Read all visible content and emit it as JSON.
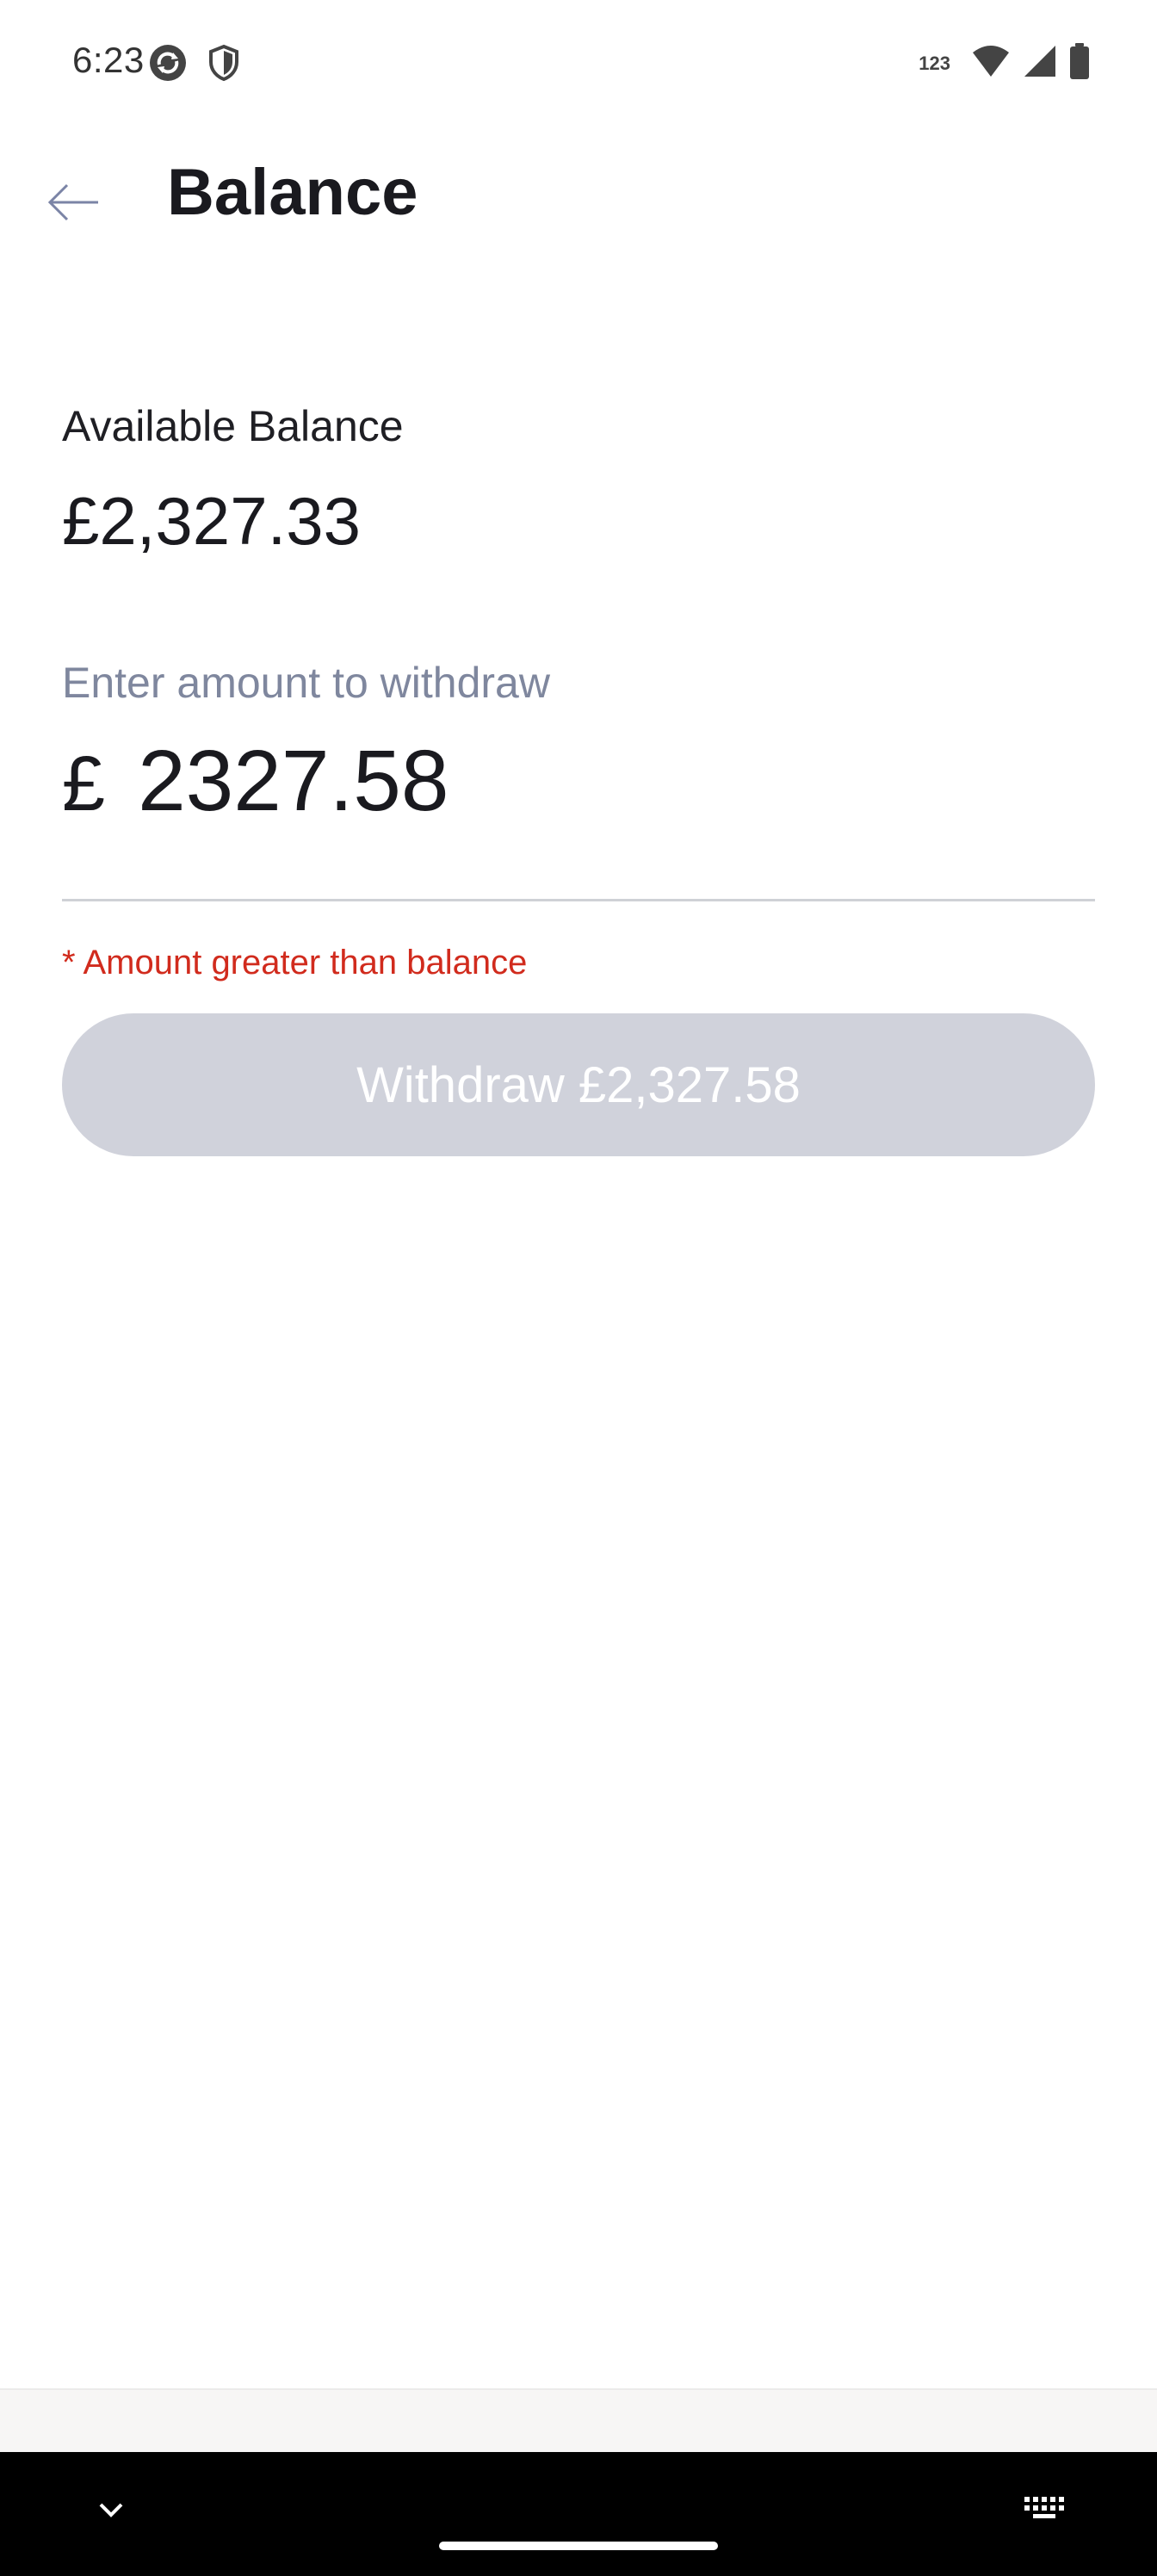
{
  "status_bar": {
    "time": "6:23",
    "left_icons": [
      "sync-icon",
      "shield-icon"
    ],
    "network_label": "123",
    "right_icons": [
      "wifi-icon",
      "signal-icon",
      "battery-icon"
    ]
  },
  "app_bar": {
    "title": "Balance",
    "back_icon": "arrow-back-icon"
  },
  "balance": {
    "label": "Available Balance",
    "value": "£2,327.33"
  },
  "withdraw": {
    "label": "Enter amount to withdraw",
    "currency_symbol": "£",
    "amount_value": "2327.58",
    "error": "* Amount greater than balance",
    "button_label": "Withdraw £2,327.58",
    "button_enabled": false
  },
  "colors": {
    "accent_error": "#d12b1d",
    "button_disabled": "#d0d2db",
    "label_muted": "#7f879e",
    "back_arrow": "#7b84a6"
  },
  "nav_bar": {
    "left_icon": "chevron-down-icon",
    "right_icon": "keyboard-icon"
  }
}
